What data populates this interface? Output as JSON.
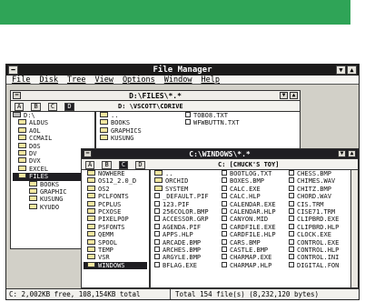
{
  "colors": {
    "banner": "#2fa457",
    "titlebar": "#1b1a1a",
    "window_bg": "#d2d0c8"
  },
  "app": {
    "title": "File Manager"
  },
  "menu": [
    "File",
    "Disk",
    "Tree",
    "View",
    "Options",
    "Window",
    "Help"
  ],
  "files_window": {
    "title": "D:\\FILES\\*.*",
    "drives": [
      "A",
      "B",
      "C",
      "D"
    ],
    "volume": "D: \\VSCOTT\\CDRIVE",
    "tree": [
      {
        "label": "D:\\",
        "icon": "drive-icon"
      },
      {
        "label": "ALDUS",
        "icon": "folder-icon"
      },
      {
        "label": "AOL",
        "icon": "folder-icon"
      },
      {
        "label": "CCMAIL",
        "icon": "folder-icon"
      },
      {
        "label": "DOS",
        "icon": "folder-icon"
      },
      {
        "label": "DV",
        "icon": "folder-icon"
      },
      {
        "label": "DVX",
        "icon": "folder-icon"
      },
      {
        "label": "EXCEL",
        "icon": "folder-icon"
      },
      {
        "label": "FILES",
        "icon": "folder-icon"
      },
      {
        "label": "BOOKS",
        "icon": "folder-icon"
      },
      {
        "label": "GRAPHIC",
        "icon": "folder-icon"
      },
      {
        "label": "KUSUNG",
        "icon": "folder-icon"
      },
      {
        "label": "KYUDO",
        "icon": "folder-icon"
      }
    ],
    "list_col1": [
      "..",
      "BOOKS",
      "GRAPHICS",
      "KUSUNG"
    ],
    "list_col2": [
      "TOBO8.TXT",
      "WFWBUTTN.TXT"
    ]
  },
  "windows_window": {
    "title": "C:\\WINDOWS\\*.*",
    "drives": [
      "A",
      "B",
      "C",
      "D"
    ],
    "volume": "C: [CHUCK'S TOY]",
    "tree": [
      "NOWHERE",
      "OS12_2.0_D",
      "OS2",
      "PCLFONTS",
      "PCPLUS",
      "PCXOSE",
      "PIXELPOP",
      "PSFONTS",
      "QEMM",
      "SPOOL",
      "TEMP",
      "VSR",
      "WINDOWS"
    ],
    "col1": [
      "..",
      "ORCHID",
      "SYSTEM",
      "_DEFAULT.PIF",
      "123.PIF",
      "256COLOR.BMP",
      "ACCESSOR.GRP",
      "AGENDA.PIF",
      "APPS.HLP",
      "ARCADE.BMP",
      "ARCHES.BMP",
      "ARGYLE.BMP",
      "BFLAG.EXE"
    ],
    "col2": [
      "BOOTLOG.TXT",
      "BOXES.BMP",
      "CALC.EXE",
      "CALC.HLP",
      "CALENDAR.EXE",
      "CALENDAR.HLP",
      "CANYON.MID",
      "CARDFILE.EXE",
      "CARDFILE.HLP",
      "CARS.BMP",
      "CASTLE.BMP",
      "CHARMAP.EXE",
      "CHARMAP.HLP"
    ],
    "col3": [
      "CHESS.BMP",
      "CHIMES.WAV",
      "CHITZ.BMP",
      "CHORD.WAV",
      "CIS.TRM",
      "CISE71.TRM",
      "CLIPBRD.EXE",
      "CLIPBRD.HLP",
      "CLOCK.EXE",
      "CONTROL.EXE",
      "CONTROL.HLP",
      "CONTROL.INI",
      "DIGITAL.FON"
    ]
  },
  "status": {
    "left": "C: 2,002KB free, 108,154KB total",
    "right": "Total 154 file(s) (8,232,120 bytes)"
  }
}
